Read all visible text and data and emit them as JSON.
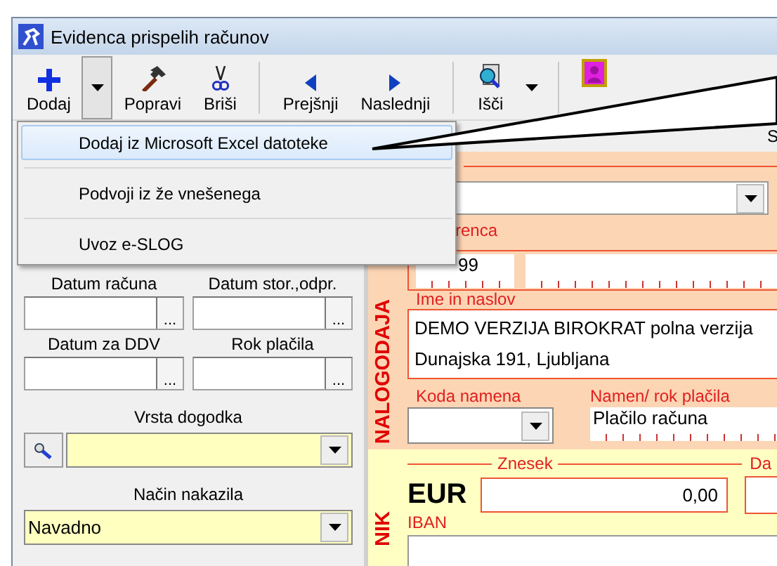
{
  "window": {
    "title": "Evidenca prispelih računov"
  },
  "toolbar": [
    {
      "kind": "button",
      "label": "Dodaj"
    },
    {
      "kind": "dropdown",
      "pressed": true
    },
    {
      "kind": "button",
      "label": "Popravi"
    },
    {
      "kind": "button",
      "label": "Briši"
    },
    {
      "kind": "separator"
    },
    {
      "kind": "button",
      "label": "Prejšnji"
    },
    {
      "kind": "button",
      "label": "Naslednji"
    },
    {
      "kind": "separator"
    },
    {
      "kind": "button",
      "label": "Išči"
    },
    {
      "kind": "dropdown",
      "pressed": false
    },
    {
      "kind": "separator"
    },
    {
      "kind": "button"
    }
  ],
  "menu": {
    "items": [
      {
        "label": "Dodaj iz Microsoft Excel datoteke",
        "selected": true
      },
      {
        "label": "Podvoji iz že vnešenega",
        "selected": false
      },
      {
        "label": "Uvoz e-SLOG",
        "selected": false
      }
    ]
  },
  "strip_label": "S",
  "left_panel": {
    "date_fields": [
      {
        "label": "Datum računa",
        "button": "..."
      },
      {
        "label": "Datum stor.,odpr.",
        "button": "..."
      },
      {
        "label": "Datum za DDV",
        "button": "..."
      },
      {
        "label": "Rok plačila",
        "button": "..."
      }
    ],
    "event_type": {
      "label": "Vrsta dogodka"
    },
    "payment_method": {
      "label": "Način nakazila",
      "value": "Navadno"
    }
  },
  "payer": {
    "side_label": "NALOGODAJA",
    "reference_label": "renca",
    "reference_model": "99",
    "name_label": "Ime in naslov",
    "name_lines": [
      "DEMO VERZIJA BIROKRAT polna verzija",
      "Dunajska 191, Ljubljana"
    ],
    "purpose_code_label": "Koda namena",
    "purpose_label": "Namen/ rok plačila",
    "purpose": "Plačilo računa"
  },
  "recipient": {
    "side_label": "NIK",
    "amount_label": "Znesek",
    "date_label": "Da",
    "currency": "EUR",
    "amount": "0,00",
    "iban_label": "IBAN"
  }
}
